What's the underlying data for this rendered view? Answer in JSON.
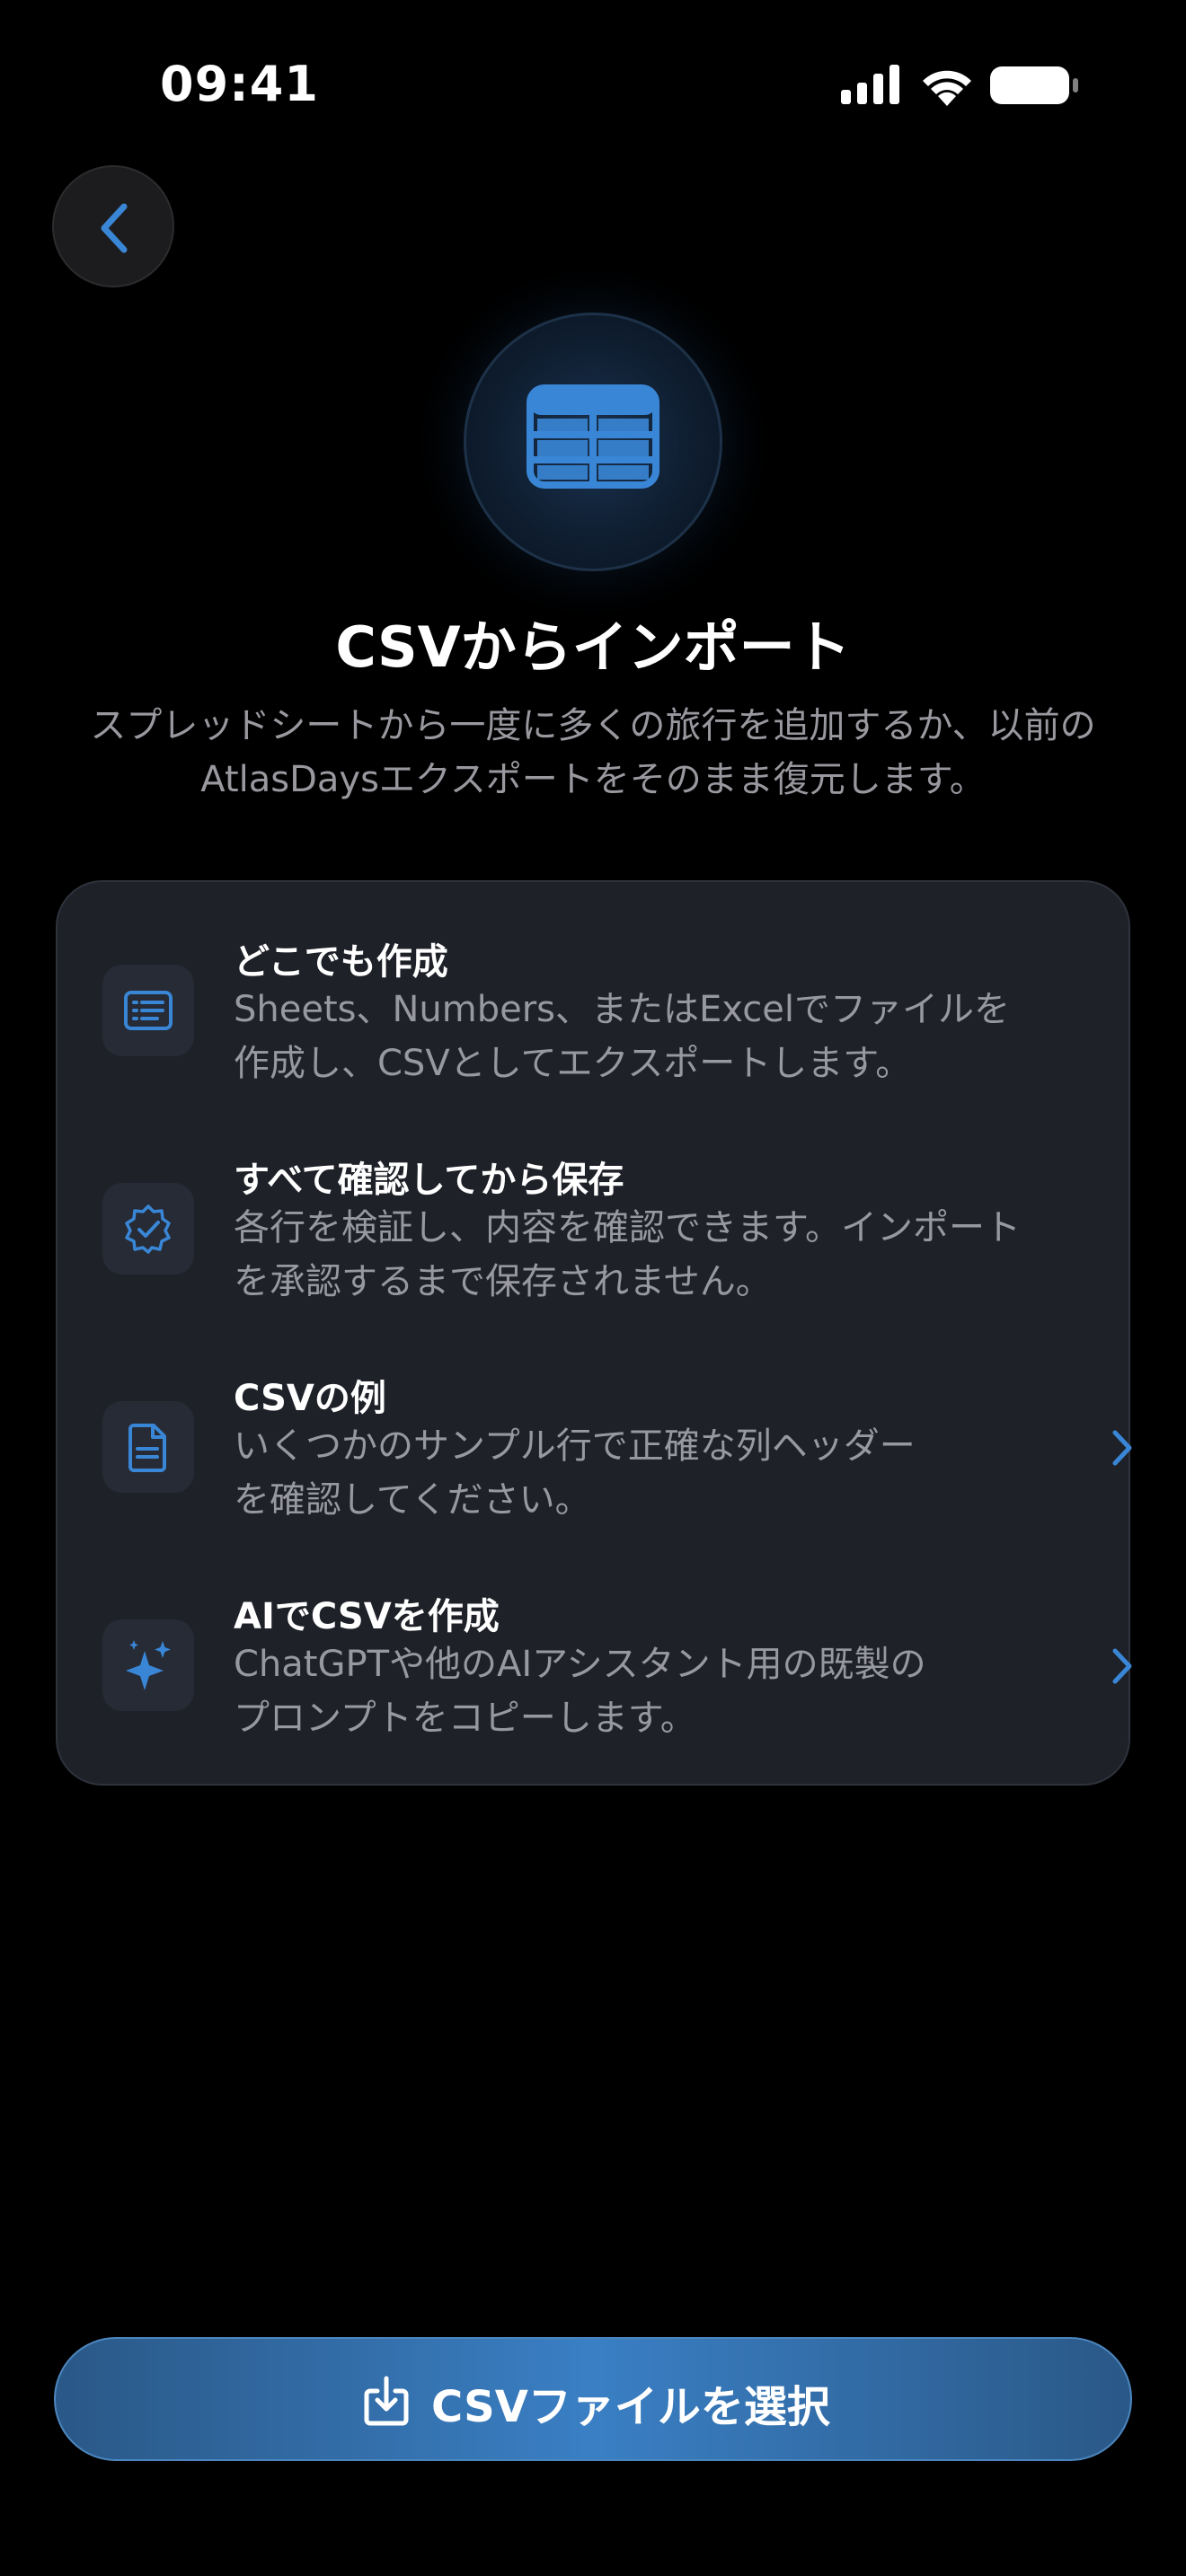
{
  "status_bar": {
    "time": "09:41"
  },
  "header": {
    "back_icon": "chevron-left-icon",
    "hero_icon": "table-icon"
  },
  "title": "CSVからインポート",
  "subtitle_line1": "スプレッドシートから一度に多くの旅行を追加するか、以前の",
  "subtitle_line2": "AtlasDaysエクスポートをそのまま復元します。",
  "features": [
    {
      "icon": "document-lines-icon",
      "title": "どこでも作成",
      "desc_line1": "Sheets、Numbers、またはExcelでファイルを",
      "desc_line2": "作成し、CSVとしてエクスポートします。"
    },
    {
      "icon": "verified-badge-icon",
      "title": "すべて確認してから保存",
      "desc_line1": "各行を検証し、内容を確認できます。インポート",
      "desc_line2": "を承認するまで保存されません。"
    },
    {
      "icon": "file-icon",
      "title": "CSVの例",
      "desc_line1": "いくつかのサンプル行で正確な列ヘッダー",
      "desc_line2": "を確認してください。"
    },
    {
      "icon": "sparkles-icon",
      "title": "AIでCSVを作成",
      "desc_line1": "ChatGPTや他のAIアシスタント用の既製の",
      "desc_line2": "プロンプトをコピーします。"
    }
  ],
  "primary_button": {
    "icon": "import-icon",
    "label": "CSVファイルを選択"
  },
  "colors": {
    "background": "#000000",
    "card": "#1e2128",
    "accent": "#3a86d6",
    "secondary_text": "#98989f"
  }
}
